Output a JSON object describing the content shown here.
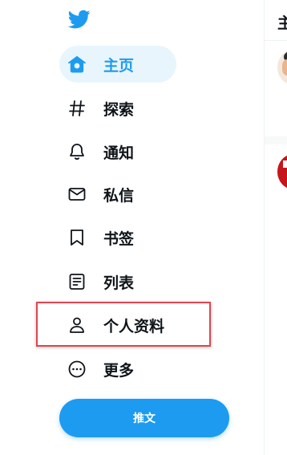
{
  "sidebar": {
    "items": [
      {
        "label": "主页",
        "icon": "home-icon",
        "active": true
      },
      {
        "label": "探索",
        "icon": "hashtag-icon",
        "active": false
      },
      {
        "label": "通知",
        "icon": "bell-icon",
        "active": false
      },
      {
        "label": "私信",
        "icon": "envelope-icon",
        "active": false
      },
      {
        "label": "书签",
        "icon": "bookmark-icon",
        "active": false
      },
      {
        "label": "列表",
        "icon": "list-icon",
        "active": false
      },
      {
        "label": "个人资料",
        "icon": "person-icon",
        "active": false
      },
      {
        "label": "更多",
        "icon": "more-circle-icon",
        "active": false
      }
    ],
    "tweet_label": "推文",
    "logo": "twitter-bird-icon"
  },
  "right": {
    "title": "主"
  },
  "colors": {
    "accent": "#1d9bf0",
    "active_bg": "#e8f5fd",
    "text": "#0f1419",
    "highlight": "#e0454f"
  }
}
